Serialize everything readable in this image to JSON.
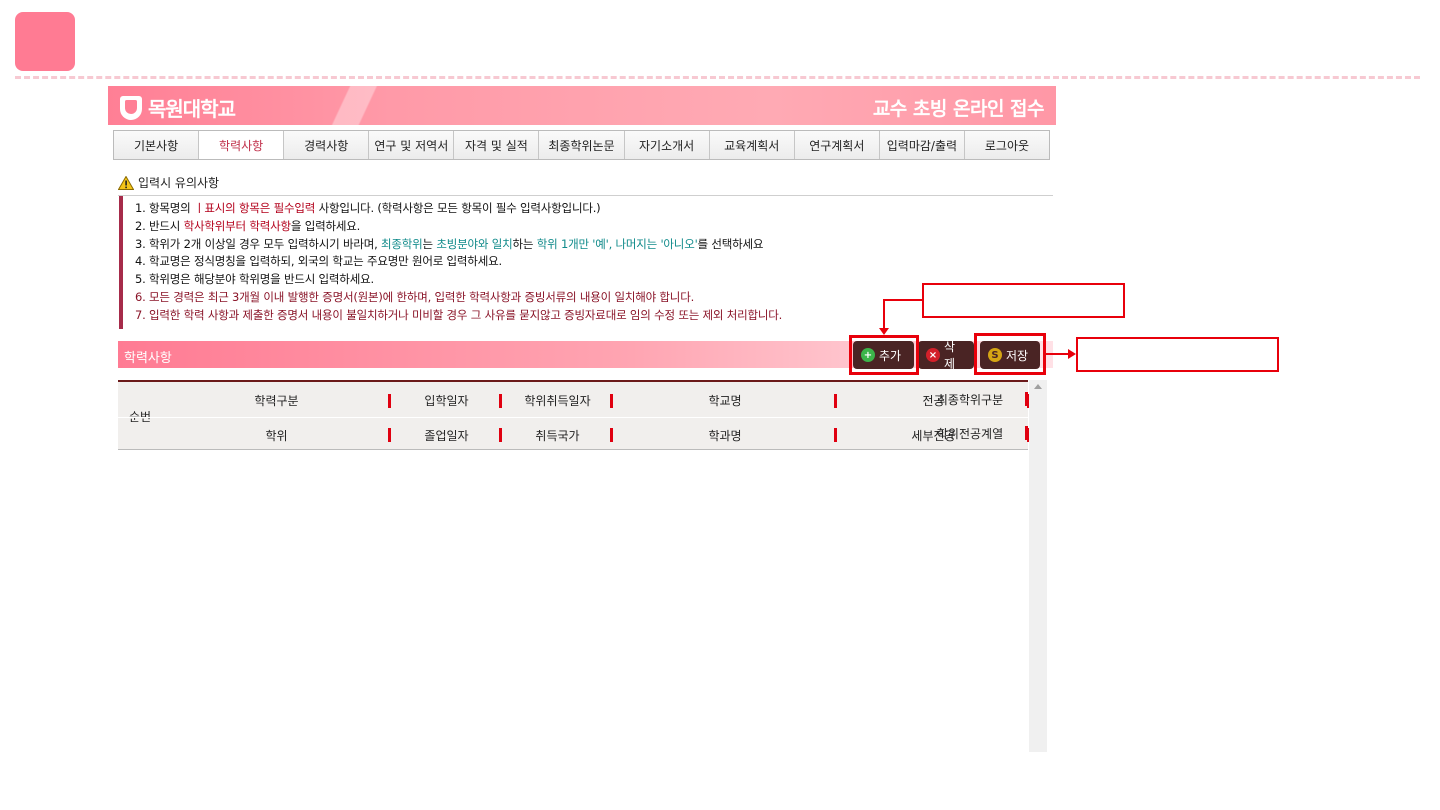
{
  "banner": {
    "logo_text": "목원대학교",
    "title": "교수 초빙 온라인 접수"
  },
  "nav": {
    "tabs": [
      {
        "label": "기본사항",
        "active": false
      },
      {
        "label": "학력사항",
        "active": true
      },
      {
        "label": "경력사항",
        "active": false
      },
      {
        "label": "연구 및 저역서",
        "active": false
      },
      {
        "label": "자격 및 실적",
        "active": false
      },
      {
        "label": "최종학위논문",
        "active": false
      },
      {
        "label": "자기소개서",
        "active": false
      },
      {
        "label": "교육계획서",
        "active": false
      },
      {
        "label": "연구계획서",
        "active": false
      },
      {
        "label": "입력마감/출력",
        "active": false
      },
      {
        "label": "로그아웃",
        "active": false
      }
    ]
  },
  "notice": {
    "heading": "입력시 유의사항",
    "line1": {
      "a": "1. 항목명의 ",
      "b": "ㅣ표시의 항목은 필수입력",
      "c": " 사항입니다. (학력사항은 모든 항목이 필수 입력사항입니다.)"
    },
    "line2": {
      "a": "2. 반드시 ",
      "b": "학사학위부터 학력사항",
      "c": "을 입력하세요."
    },
    "line3": {
      "a": "3. 학위가 2개 이상일 경우 모두 입력하시기 바라며, ",
      "b": "최종학위",
      "c": "는 ",
      "d": "초빙분야와 일치",
      "e": "하는 ",
      "f": "학위 1개만 '예', 나머지는 '아니오'",
      "g": "를 선택하세요"
    },
    "line4": "4. 학교명은 정식명칭을 입력하되, 외국의 학교는 주요명만 원어로 입력하세요.",
    "line5": "5. 학위명은 해당분야 학위명을 반드시 입력하세요.",
    "line6": "6. 모든 경력은 최근 3개월 이내 발행한 증명서(원본)에 한하며, 입력한 학력사항과 증빙서류의 내용이 일치해야 합니다.",
    "line7": "7. 입력한 학력 사항과 제출한 증명서 내용이 불일치하거나 미비할 경우 그 사유를 묻지않고 증빙자료대로 임의 수정 또는 제외 처리합니다."
  },
  "section": {
    "title": "학력사항",
    "buttons": {
      "add": "추가",
      "delete": "삭제",
      "save": "저장"
    }
  },
  "grid": {
    "num_header": "순번",
    "row1": [
      "학력구분",
      "입학일자",
      "학위취득일자",
      "학교명",
      "전공",
      "최종학위구분"
    ],
    "row2": [
      "학위",
      "졸업일자",
      "취득국가",
      "학과명",
      "세부전공",
      "학위전공계열"
    ]
  },
  "colors": {
    "accent": "#ff7b93",
    "button_bg": "#4a2424",
    "highlight": "#e8000b",
    "notice_border": "#a62b4a"
  }
}
